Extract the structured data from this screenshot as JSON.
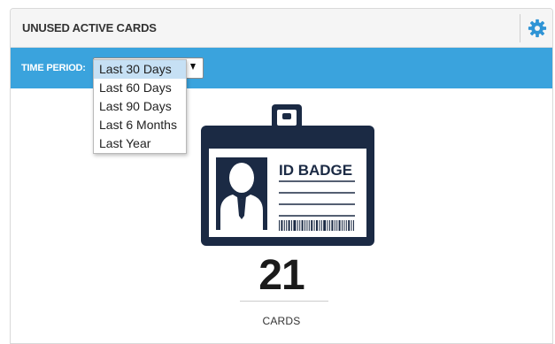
{
  "widget": {
    "title": "UNUSED ACTIVE CARDS",
    "settings_icon": "gear-icon"
  },
  "filter": {
    "label": "TIME PERIOD:",
    "options": [
      "Last 30 Days",
      "Last 60 Days",
      "Last 90 Days",
      "Last 6 Months",
      "Last Year"
    ],
    "selected": "Last 30 Days",
    "expanded": true
  },
  "badge": {
    "icon": "id-badge-icon",
    "label": "ID BADGE"
  },
  "metric": {
    "value": "21",
    "unit": "CARDS"
  },
  "colors": {
    "accent": "#3aa3dd",
    "badge": "#1b2a44",
    "gear": "#2f94d5",
    "header_bg": "#f5f5f5"
  }
}
